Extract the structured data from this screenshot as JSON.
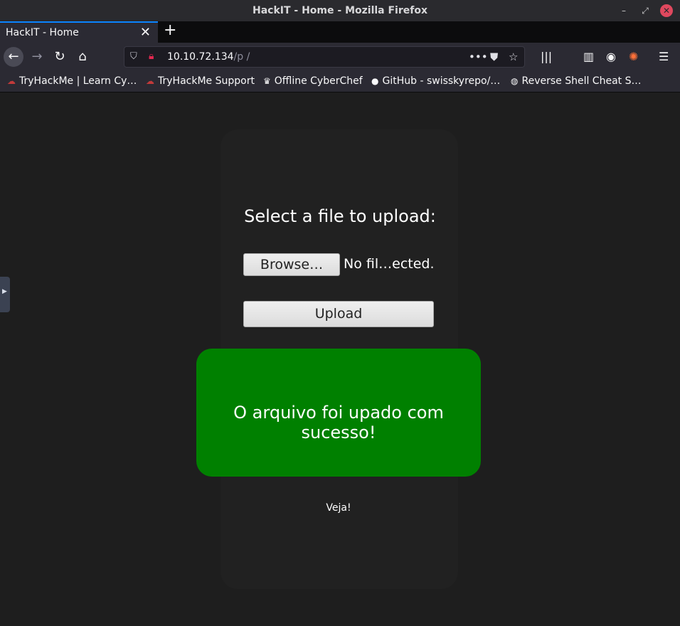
{
  "window": {
    "title": "HackIT - Home - Mozilla Firefox"
  },
  "tabs": [
    {
      "label": "HackIT - Home",
      "close_glyph": "✕"
    }
  ],
  "newtab_glyph": "+",
  "navbar": {
    "url_host": "10.10.72.134",
    "url_path": "/p        /",
    "icons": [
      "back-icon",
      "forward-icon",
      "reload-icon",
      "home-icon",
      "shield-icon",
      "insecure-lock-icon",
      "page-actions-icon",
      "pocket-icon",
      "bookmark-star-icon",
      "library-icon",
      "sidebar-icon",
      "account-icon",
      "extension-icon",
      "menu-icon"
    ]
  },
  "bookmarks": [
    {
      "label": "TryHackMe | Learn Cy…",
      "icon": "cloud-icon"
    },
    {
      "label": "TryHackMe Support",
      "icon": "cloud-icon"
    },
    {
      "label": "Offline CyberChef",
      "icon": "chef-hat-icon"
    },
    {
      "label": "GitHub - swisskyrepo/…",
      "icon": "github-icon"
    },
    {
      "label": "Reverse Shell Cheat S…",
      "icon": "globe-icon"
    }
  ],
  "page": {
    "heading": "Select a file to upload:",
    "browse_label": "Browse…",
    "no_file_text": "No fil…ected.",
    "upload_label": "Upload",
    "success_message": "O arquivo foi upado com sucesso!",
    "veja_text": "Veja!"
  },
  "colors": {
    "success": "#008000",
    "background": "#1e1e1e",
    "accent": "#0a84ff"
  }
}
